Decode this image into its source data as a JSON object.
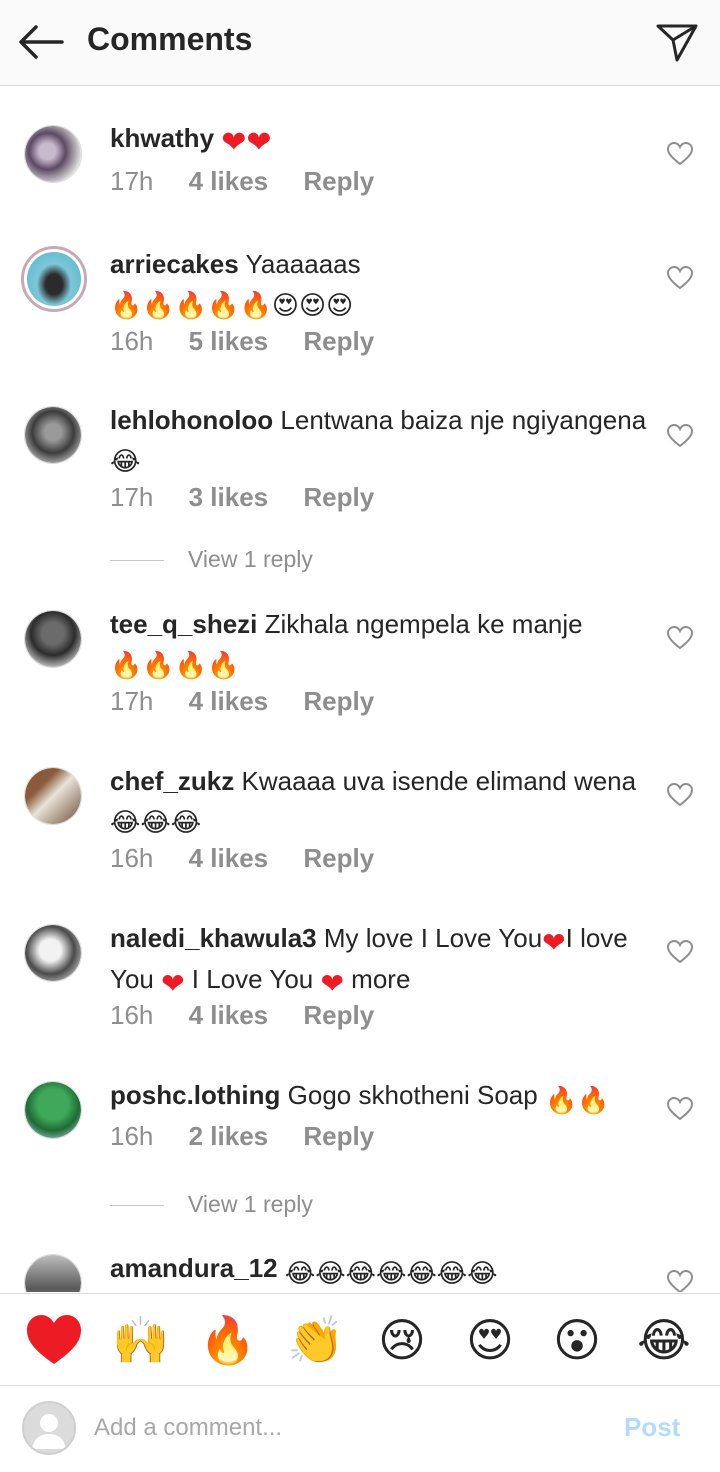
{
  "header": {
    "title": "Comments",
    "back_icon": "arrow-left-icon",
    "send_icon": "paper-plane-icon"
  },
  "comments": [
    {
      "username": "khwathy",
      "text": "",
      "emoji": "❤❤",
      "time": "17h",
      "likes": "4 likes",
      "reply": "Reply"
    },
    {
      "username": "arriecakes",
      "text": "Yaaaaaas",
      "line2_emoji": "🔥🔥🔥🔥🔥😍😍😍",
      "time": "16h",
      "likes": "5 likes",
      "reply": "Reply"
    },
    {
      "username": "lehlohonoloo",
      "text": "Lentwana baiza nje ngiyangena",
      "emoji": "😂",
      "time": "17h",
      "likes": "3 likes",
      "reply": "Reply",
      "view_replies": "View 1 reply"
    },
    {
      "username": "tee_q_shezi",
      "text": "Zikhala ngempela ke manje",
      "line2_emoji": "🔥🔥🔥🔥",
      "time": "17h",
      "likes": "4 likes",
      "reply": "Reply"
    },
    {
      "username": "chef_zukz",
      "text": "Kwaaaa uva isende elimand wena",
      "emoji": "😂😂😂",
      "time": "16h",
      "likes": "4 likes",
      "reply": "Reply"
    },
    {
      "username": "naledi_khawula3",
      "text_parts": [
        "My love I Love You",
        "❤",
        "I love You ",
        "❤",
        " I Love You ",
        "❤",
        " more"
      ],
      "time": "16h",
      "likes": "4 likes",
      "reply": "Reply"
    },
    {
      "username": "poshc.lothing",
      "text": "Gogo skhotheni Soap",
      "emoji": "🔥🔥",
      "time": "16h",
      "likes": "2 likes",
      "reply": "Reply",
      "view_replies": "View 1 reply"
    },
    {
      "username": "amandura_12",
      "text": "",
      "emoji": "😂😂😂😂😂😂😂"
    }
  ],
  "reactions": [
    "❤",
    "🙌",
    "🔥",
    "👏",
    "😢",
    "😍",
    "😮",
    "😂"
  ],
  "composer": {
    "placeholder": "Add a comment...",
    "post_label": "Post"
  },
  "colors": {
    "text": "#262626",
    "secondary": "#8e8e8e",
    "post_disabled": "#b3dbff",
    "divider": "#dbdbdb",
    "heart_red": "#ed1c24"
  }
}
